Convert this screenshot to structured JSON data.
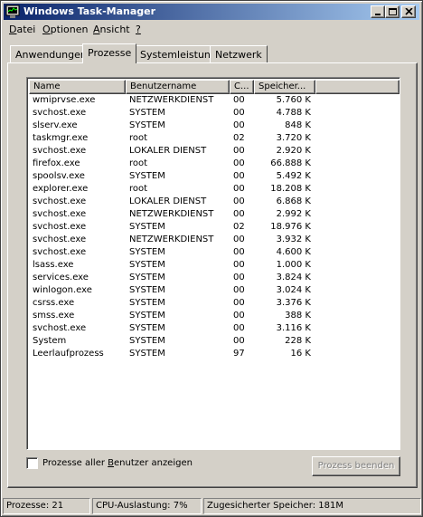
{
  "window": {
    "title": "Windows Task-Manager",
    "menu": [
      {
        "label": "Datei",
        "mnemonic": "D"
      },
      {
        "label": "Optionen",
        "mnemonic": "O"
      },
      {
        "label": "Ansicht",
        "mnemonic": "A"
      },
      {
        "label": "?",
        "mnemonic": "?"
      }
    ]
  },
  "tabs": [
    "Anwendungen",
    "Prozesse",
    "Systemleistung",
    "Netzwerk"
  ],
  "active_tab": "Prozesse",
  "table": {
    "columns": [
      "Name",
      "Benutzername",
      "C...",
      "Speicher..."
    ],
    "rows": [
      [
        "wmiprvse.exe",
        "NETZWERKDIENST",
        "00",
        "5.760 K"
      ],
      [
        "svchost.exe",
        "SYSTEM",
        "00",
        "4.788 K"
      ],
      [
        "slserv.exe",
        "SYSTEM",
        "00",
        "848 K"
      ],
      [
        "taskmgr.exe",
        "root",
        "02",
        "3.720 K"
      ],
      [
        "svchost.exe",
        "LOKALER DIENST",
        "00",
        "2.920 K"
      ],
      [
        "firefox.exe",
        "root",
        "00",
        "66.888 K"
      ],
      [
        "spoolsv.exe",
        "SYSTEM",
        "00",
        "5.492 K"
      ],
      [
        "explorer.exe",
        "root",
        "00",
        "18.208 K"
      ],
      [
        "svchost.exe",
        "LOKALER DIENST",
        "00",
        "6.868 K"
      ],
      [
        "svchost.exe",
        "NETZWERKDIENST",
        "00",
        "2.992 K"
      ],
      [
        "svchost.exe",
        "SYSTEM",
        "02",
        "18.976 K"
      ],
      [
        "svchost.exe",
        "NETZWERKDIENST",
        "00",
        "3.932 K"
      ],
      [
        "svchost.exe",
        "SYSTEM",
        "00",
        "4.600 K"
      ],
      [
        "lsass.exe",
        "SYSTEM",
        "00",
        "1.000 K"
      ],
      [
        "services.exe",
        "SYSTEM",
        "00",
        "3.824 K"
      ],
      [
        "winlogon.exe",
        "SYSTEM",
        "00",
        "3.024 K"
      ],
      [
        "csrss.exe",
        "SYSTEM",
        "00",
        "3.376 K"
      ],
      [
        "smss.exe",
        "SYSTEM",
        "00",
        "388 K"
      ],
      [
        "svchost.exe",
        "SYSTEM",
        "00",
        "3.116 K"
      ],
      [
        "System",
        "SYSTEM",
        "00",
        "228 K"
      ],
      [
        "Leerlaufprozess",
        "SYSTEM",
        "97",
        "16 K"
      ]
    ]
  },
  "show_all_users": {
    "label": "Prozesse aller Benutzer anzeigen",
    "checked": false
  },
  "end_process_button": "Prozess beenden",
  "status": {
    "processes": "Prozesse: 21",
    "cpu": "CPU-Auslastung: 7%",
    "memory": "Zugesicherter Speicher: 181M"
  }
}
